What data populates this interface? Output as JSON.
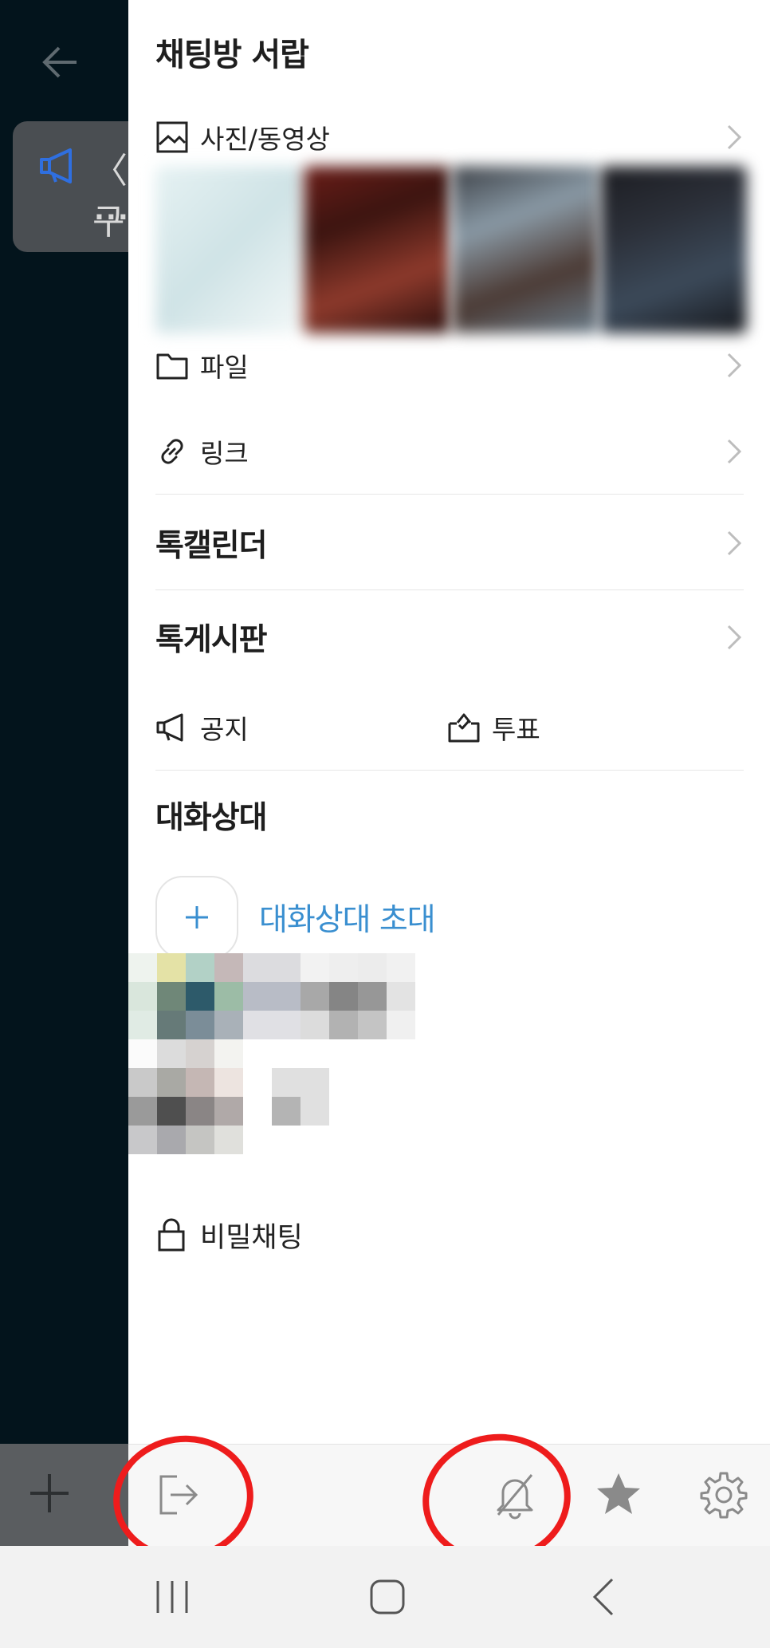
{
  "background_chat": {
    "notice_text": "〈 구",
    "notice_dots": "..."
  },
  "drawer": {
    "title": "채팅방 서랍",
    "photos_label": "사진/동영상",
    "files_label": "파일",
    "links_label": "링크",
    "calendar_label": "톡캘린더",
    "board_label": "톡게시판",
    "notice_label": "공지",
    "vote_label": "투표",
    "members_title": "대화상대",
    "invite_label": "대화상대 초대",
    "secret_chat_label": "비밀채팅"
  },
  "toolbar": {
    "icons": [
      "exit-icon",
      "bell-off-icon",
      "star-icon",
      "gear-icon"
    ]
  },
  "colors": {
    "accent_blue": "#3a8fd0",
    "annotation_red": "#ee1c1c",
    "chat_background": "#03141c"
  }
}
